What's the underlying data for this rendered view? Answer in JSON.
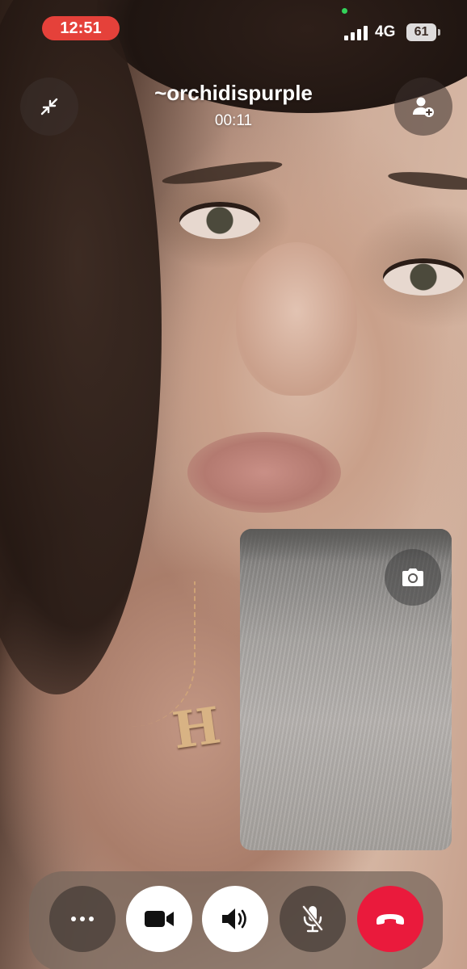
{
  "status_bar": {
    "time": "12:51",
    "network": "4G",
    "battery": "61"
  },
  "call": {
    "caller_name": "~orchidispurple",
    "duration": "00:11"
  },
  "icons": {
    "minimize": "minimize-icon",
    "add_person": "add-person-icon",
    "flip_camera": "camera-icon",
    "more": "more-icon",
    "video": "video-camera-icon",
    "speaker": "speaker-icon",
    "mute": "microphone-off-icon",
    "end_call": "end-call-icon"
  },
  "colors": {
    "time_pill": "#e5413a",
    "end_call": "#ea1a3c",
    "active_control": "#ffffff"
  }
}
